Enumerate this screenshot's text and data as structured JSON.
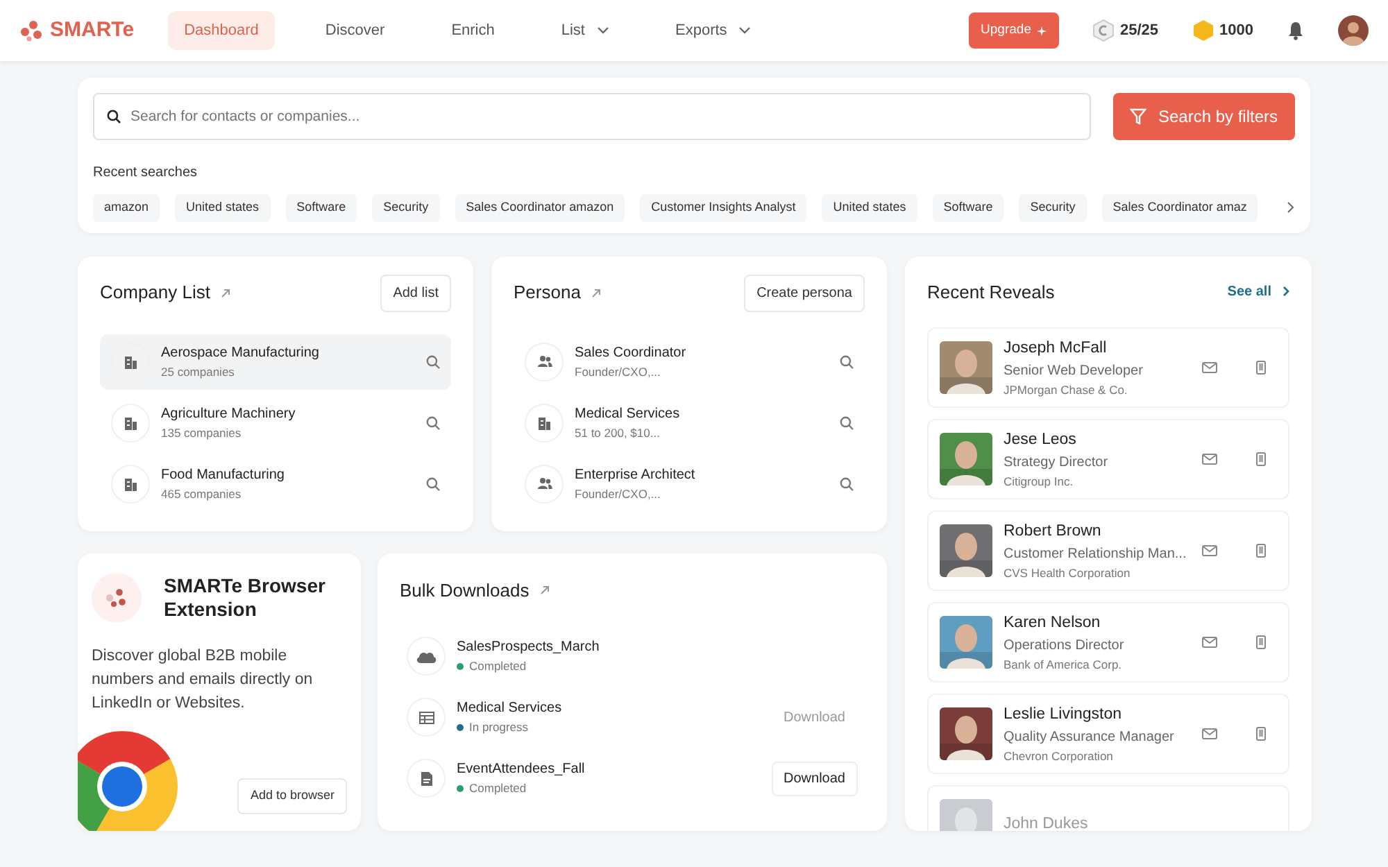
{
  "brand": {
    "name": "SMARTe"
  },
  "nav": [
    {
      "label": "Dashboard",
      "selected": true,
      "dropdown": false
    },
    {
      "label": "Discover",
      "selected": false,
      "dropdown": false
    },
    {
      "label": "Enrich",
      "selected": false,
      "dropdown": false
    },
    {
      "label": "List",
      "selected": false,
      "dropdown": true
    },
    {
      "label": "Exports",
      "selected": false,
      "dropdown": true
    }
  ],
  "header": {
    "upgrade": "Upgrade",
    "credits": "25/25",
    "coins": "1000"
  },
  "search": {
    "placeholder": "Search for contacts or companies...",
    "button": "Search by filters",
    "recent_label": "Recent searches",
    "recent": [
      "amazon",
      "United states",
      "Software",
      "Security",
      "Sales Coordinator amazon",
      "Customer Insights Analyst",
      "United states",
      "Software",
      "Security",
      "Sales Coordinator amaz"
    ]
  },
  "company_list": {
    "title": "Company List",
    "button": "Add list",
    "items": [
      {
        "name": "Aerospace Manufacturing",
        "detail": "25 companies",
        "selected": true
      },
      {
        "name": "Agriculture Machinery",
        "detail": "135 companies",
        "selected": false
      },
      {
        "name": "Food Manufacturing",
        "detail": "465 companies",
        "selected": false
      }
    ]
  },
  "persona": {
    "title": "Persona",
    "button": "Create persona",
    "items": [
      {
        "name": "Sales Coordinator",
        "detail": "Founder/CXO,...",
        "kind": "people"
      },
      {
        "name": "Medical Services",
        "detail": "51 to 200, $10...",
        "kind": "company"
      },
      {
        "name": "Enterprise Architect",
        "detail": "Founder/CXO,...",
        "kind": "people"
      }
    ]
  },
  "extension": {
    "title": "SMARTe Browser Extension",
    "text": "Discover global B2B mobile numbers and emails directly on LinkedIn or Websites.",
    "button": "Add to browser"
  },
  "bulk_downloads": {
    "title": "Bulk Downloads",
    "items": [
      {
        "name": "SalesProspects_March",
        "status": "Completed",
        "kind": "cloud",
        "color": "#2e9d6e"
      },
      {
        "name": "Medical Services",
        "status": "In progress",
        "kind": "table",
        "color": "#1f6f8b",
        "download": "Download",
        "disabled": true
      },
      {
        "name": "EventAttendees_Fall",
        "status": "Completed",
        "kind": "file",
        "color": "#2e9d6e",
        "download": "Download",
        "disabled": false
      }
    ]
  },
  "recent_reveals": {
    "title": "Recent Reveals",
    "see_all": "See all",
    "people": [
      {
        "name": "Joseph McFall",
        "title": "Senior Web Developer",
        "company": "JPMorgan Chase & Co.",
        "color": "#a08a70"
      },
      {
        "name": "Jese Leos",
        "title": "Strategy Director",
        "company": "Citigroup Inc.",
        "color": "#4f8f4a"
      },
      {
        "name": "Robert Brown",
        "title": "Customer Relationship Man...",
        "company": "CVS Health Corporation",
        "color": "#6f6f72"
      },
      {
        "name": "Karen Nelson",
        "title": "Operations Director",
        "company": "Bank of America Corp.",
        "color": "#5f9ec0"
      },
      {
        "name": "Leslie Livingston",
        "title": "Quality Assurance Manager",
        "company": "Chevron Corporation",
        "color": "#7a3d3a"
      },
      {
        "name": "John Dukes",
        "color": "#c9ccd0"
      }
    ]
  }
}
